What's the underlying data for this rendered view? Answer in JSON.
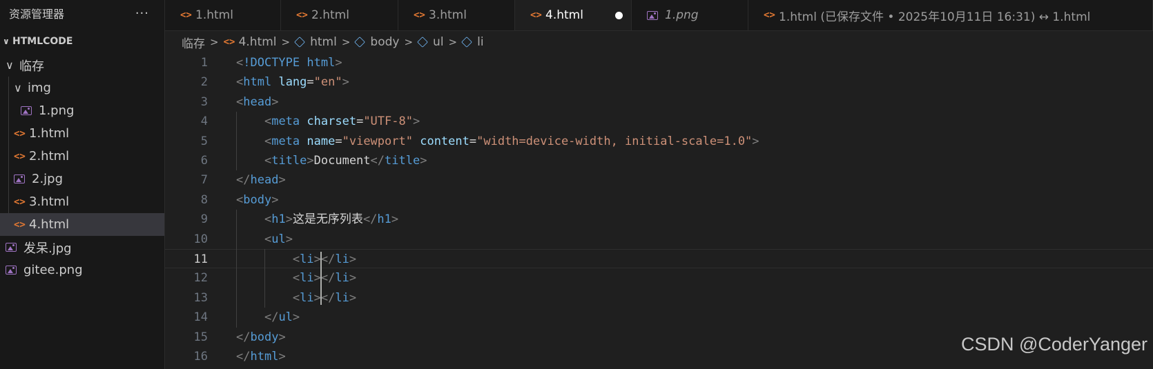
{
  "sidebar": {
    "title": "资源管理器",
    "more": "···",
    "section": "HTMLCODE",
    "tree": [
      {
        "label": "临存",
        "type": "folder",
        "level": 0
      },
      {
        "label": "img",
        "type": "folder",
        "level": 1
      },
      {
        "label": "1.png",
        "type": "image",
        "level": 2
      },
      {
        "label": "1.html",
        "type": "html",
        "level": 1
      },
      {
        "label": "2.html",
        "type": "html",
        "level": 1
      },
      {
        "label": "2.jpg",
        "type": "image",
        "level": 1
      },
      {
        "label": "3.html",
        "type": "html",
        "level": 1
      },
      {
        "label": "4.html",
        "type": "html",
        "level": 1,
        "selected": true
      },
      {
        "label": "发呆.jpg",
        "type": "image",
        "level": 0
      },
      {
        "label": "gitee.png",
        "type": "image",
        "level": 0
      }
    ]
  },
  "tabs": [
    {
      "label": "1.html",
      "icon": "html"
    },
    {
      "label": "2.html",
      "icon": "html"
    },
    {
      "label": "3.html",
      "icon": "html"
    },
    {
      "label": "4.html",
      "icon": "html",
      "active": true,
      "modified": true
    },
    {
      "label": "1.png",
      "icon": "image",
      "italic": true
    },
    {
      "label": "1.html (已保存文件 • 2025年10月11日 16:31) ↔ 1.html",
      "icon": "html"
    }
  ],
  "breadcrumb": [
    "临存",
    "4.html",
    "html",
    "body",
    "ul",
    "li"
  ],
  "code_lines": [
    "<!DOCTYPE html>",
    "<html lang=\"en\">",
    "<head>",
    "    <meta charset=\"UTF-8\">",
    "    <meta name=\"viewport\" content=\"width=device-width, initial-scale=1.0\">",
    "    <title>Document</title>",
    "</head>",
    "<body>",
    "    <h1>这是无序列表</h1>",
    "    <ul>",
    "        <li></li>",
    "        <li></li>",
    "        <li></li>",
    "    </ul>",
    "</body>",
    "</html>"
  ],
  "current_line": 11,
  "watermark": "CSDN @CoderYanger",
  "colors": {
    "tag": "#569cd6",
    "attr": "#9cdcfe",
    "string": "#ce9178",
    "html_icon": "#e37933",
    "image_icon": "#a074c4"
  }
}
